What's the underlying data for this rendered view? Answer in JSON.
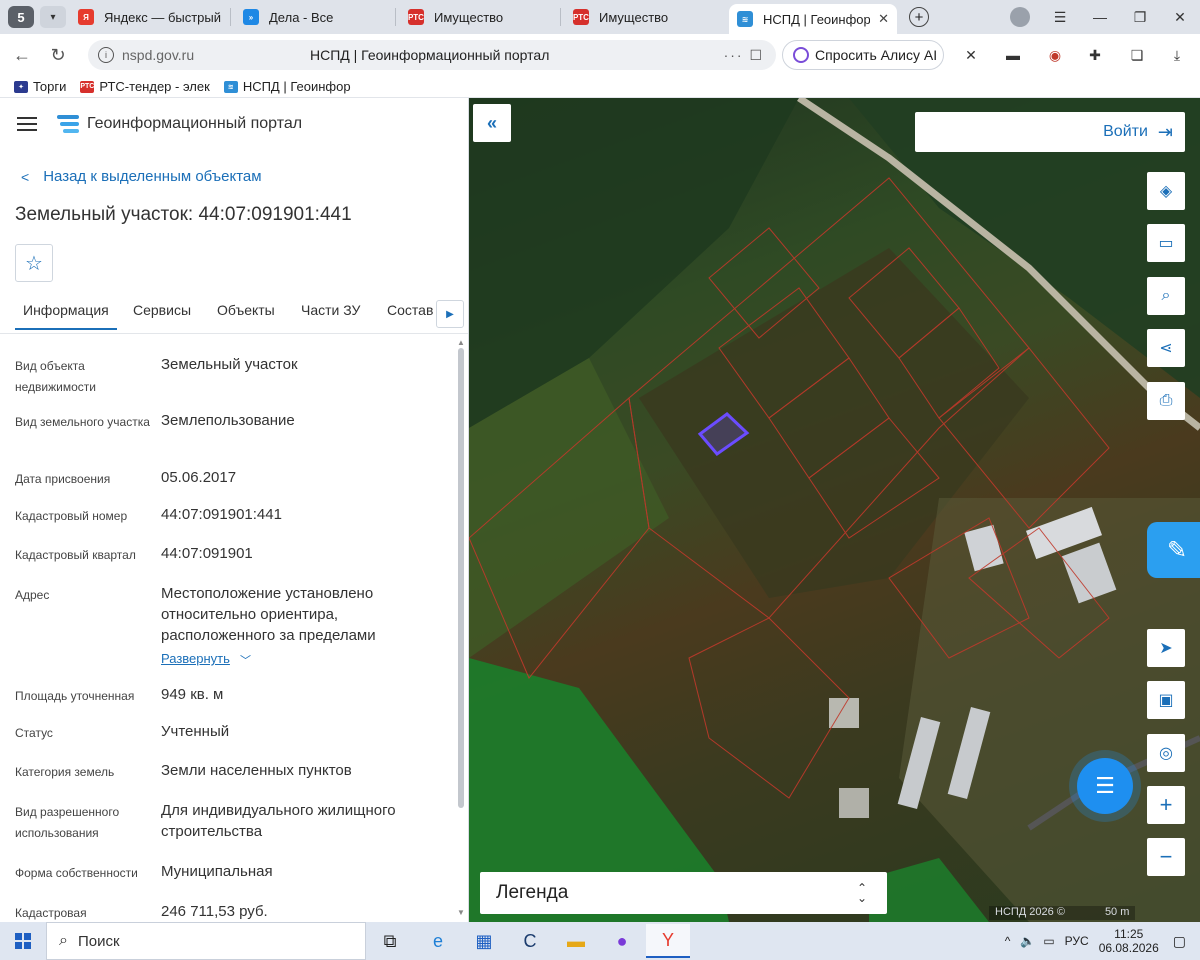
{
  "browser": {
    "tab_count": "5",
    "tabs": [
      {
        "label": "Яндекс — быстрый по",
        "icon": "yandex-icon",
        "color": "#e63b2e"
      },
      {
        "label": "Дела - Все",
        "icon": "tasks-icon",
        "color": "#1e88e5"
      },
      {
        "label": "Имущество",
        "icon": "rts-icon",
        "color": "#d6302c"
      },
      {
        "label": "Имущество",
        "icon": "rts-icon",
        "color": "#d6302c"
      },
      {
        "label": "НСПД | Геоинформ",
        "icon": "nspd-icon",
        "color": "#2f8fd6"
      }
    ],
    "address": {
      "domain": "nspd.gov.ru",
      "page_title": "НСПД | Геоинформационный портал",
      "alice_label": "Спросить Алису AI"
    },
    "bookmarks": [
      {
        "label": "Торги",
        "icon": "eagle-icon"
      },
      {
        "label": "РТС-тендер - элек",
        "icon": "rts-icon"
      },
      {
        "label": "НСПД | Геоинфор",
        "icon": "nspd-icon"
      }
    ]
  },
  "portal": {
    "title": "Геоинформационный портал",
    "back_label": "Назад к выделенным объектам",
    "object_title": "Земельный участок: 44:07:091901:441",
    "tabs": [
      "Информация",
      "Сервисы",
      "Объекты",
      "Части ЗУ",
      "Состав"
    ],
    "active_tab": "Информация",
    "attributes": [
      {
        "key": "Вид объекта недвижимости",
        "value": "Земельный участок"
      },
      {
        "key": "Вид земельного участка",
        "value": "Землепользование"
      },
      {
        "key": "Дата присвоения",
        "value": "05.06.2017"
      },
      {
        "key": "Кадастровый номер",
        "value": "44:07:091901:441"
      },
      {
        "key": "Кадастровый квартал",
        "value": "44:07:091901"
      },
      {
        "key": "Адрес",
        "value": "Местоположение установлено относительно ориентира, расположенного за пределами"
      },
      {
        "key": "Площадь уточненная",
        "value": "949 кв. м"
      },
      {
        "key": "Статус",
        "value": "Учтенный"
      },
      {
        "key": "Категория земель",
        "value": "Земли населенных пунктов"
      },
      {
        "key": "Вид разрешенного использования",
        "value": "Для индивидуального жилищного строительства"
      },
      {
        "key": "Форма собственности",
        "value": "Муниципальная"
      },
      {
        "key": "Кадастровая",
        "value": "246 711,53 руб."
      }
    ],
    "expand_label": "Развернуть"
  },
  "map": {
    "login_label": "Войти",
    "legend_label": "Легенда",
    "attribution": "НСПД 2026 ©",
    "scale_label": "50 m",
    "tools": [
      "layers-icon",
      "ruler-icon",
      "search-area-icon",
      "share-icon",
      "print-icon"
    ],
    "bottom_tools": [
      "locate-icon",
      "minimap-icon",
      "gps-icon",
      "zoom-in-icon",
      "zoom-out-icon"
    ],
    "colors": {
      "parcel_border": "#c0392b",
      "selected_parcel": "#6b4cff",
      "accent": "#1b6fb8"
    }
  },
  "taskbar": {
    "search_placeholder": "Поиск",
    "language": "РУС",
    "time": "11:25",
    "date": "06.08.2026"
  }
}
